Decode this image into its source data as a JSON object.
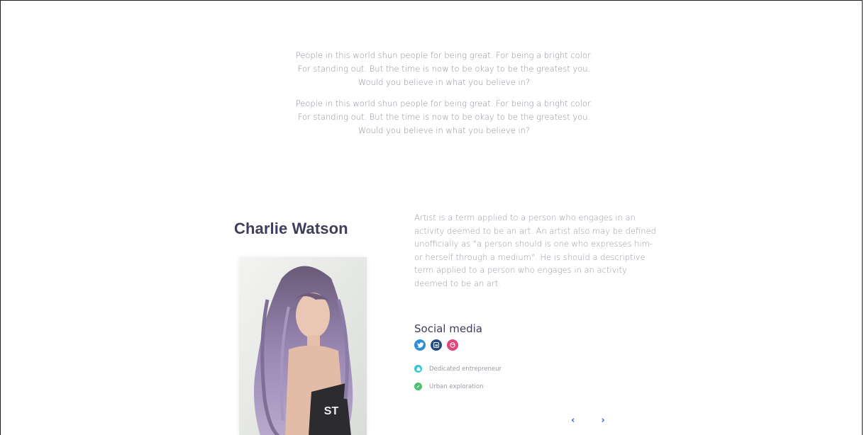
{
  "quotes": [
    {
      "lines": [
        "People in this world shun people for being great. For being a bright color.",
        "For standing out. But the time is now to be okay to be the greatest you.",
        "Would you believe in what you believe in?"
      ]
    },
    {
      "lines": [
        "People in this world shun people for being great. For being a bright color.",
        "For standing out. But the time is now to be okay to be the greatest you.",
        "Would you believe in what you believe in?"
      ]
    }
  ],
  "profile": {
    "name": "Charlie Watson",
    "bio": "Artist is a term applied to a person who engages in an activity deemed to be an art. An artist also may be defined unofficially as \"a person should is one who expresses him- or herself through a medium\". He is should a descriptive term applied to a person who engages in an activity deemed to be an art.",
    "social_title": "Social media",
    "social_links": [
      {
        "icon": "twitter-icon",
        "color": "#2d8ed8"
      },
      {
        "icon": "linkedin-icon",
        "color": "#244a86"
      },
      {
        "icon": "dribbble-icon",
        "color": "#e0457b"
      }
    ],
    "tags": [
      {
        "label": "Dedicated entrepreneur",
        "icon": "briefcase-icon",
        "color": "#38c4d8"
      },
      {
        "label": "Urban exploration",
        "icon": "compass-icon",
        "color": "#4cbf73"
      }
    ]
  },
  "pager": {
    "prev": "‹",
    "next": "›"
  }
}
